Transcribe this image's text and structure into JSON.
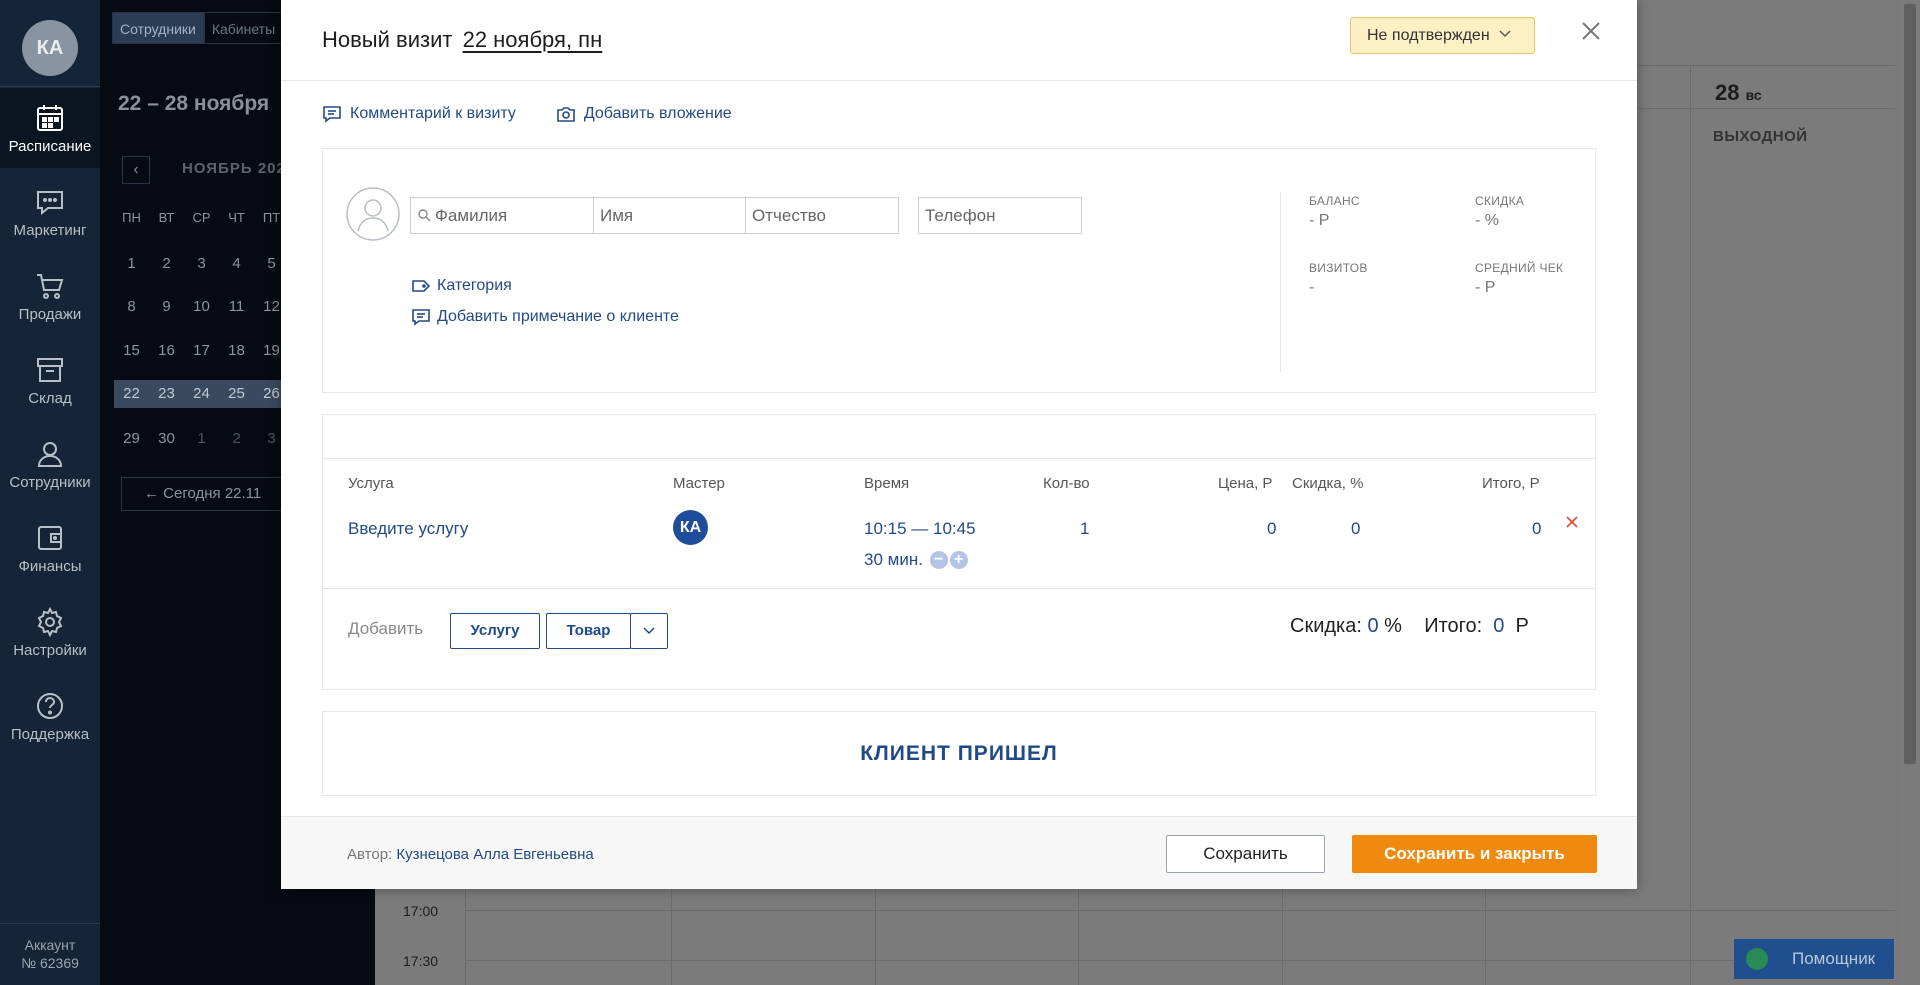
{
  "nav": {
    "avatar": "КА",
    "items": [
      {
        "label": "Расписание"
      },
      {
        "label": "Маркетинг"
      },
      {
        "label": "Продажи"
      },
      {
        "label": "Склад"
      },
      {
        "label": "Сотрудники"
      },
      {
        "label": "Финансы"
      },
      {
        "label": "Настройки"
      },
      {
        "label": "Поддержка"
      }
    ],
    "account_label": "Аккаунт",
    "account_number": "№ 62369"
  },
  "sidebar": {
    "tabs": [
      "Сотрудники",
      "Кабинеты"
    ],
    "range": "22 – 28 ноября",
    "month": "НОЯБРЬ 202",
    "weekdays": [
      "ПН",
      "ВТ",
      "СР",
      "ЧТ",
      "ПТ"
    ],
    "weeks": [
      [
        "1",
        "2",
        "3",
        "4",
        "5"
      ],
      [
        "8",
        "9",
        "10",
        "11",
        "12"
      ],
      [
        "15",
        "16",
        "17",
        "18",
        "19"
      ],
      [
        "22",
        "23",
        "24",
        "25",
        "26"
      ],
      [
        "29",
        "30",
        "1",
        "2",
        "3"
      ]
    ],
    "today_btn": "Сегодня 22.11"
  },
  "schedule": {
    "day_num": "28",
    "day_name": "вс",
    "day_off": "ВЫХОДНОЙ",
    "times": [
      "17:00",
      "17:30"
    ],
    "helper": "Помощник"
  },
  "modal": {
    "title": "Новый визит",
    "date": "22 ноября, пн",
    "status": "Не подтвержден",
    "links": {
      "comment": "Комментарий к визиту",
      "attachment": "Добавить вложение"
    },
    "client": {
      "surname_placeholder": "Фамилия",
      "name_placeholder": "Имя",
      "patronymic_placeholder": "Отчество",
      "phone_placeholder": "Телефон",
      "category": "Категория",
      "note": "Добавить примечание о клиенте",
      "stats": {
        "balance_label": "БАЛАНС",
        "balance": "- Р",
        "discount_label": "СКИДКА",
        "discount": "- %",
        "visits_label": "ВИЗИТОВ",
        "visits": "-",
        "avg_label": "СРЕДНИЙ ЧЕК",
        "avg": "- Р"
      }
    },
    "services": {
      "headers": {
        "service": "Услуга",
        "master": "Мастер",
        "time": "Время",
        "qty": "Кол-во",
        "price": "Цена, Р",
        "discount": "Скидка, %",
        "total": "Итого, Р"
      },
      "row": {
        "service": "Введите услугу",
        "master": "КА",
        "time": "10:15 — 10:45",
        "duration": "30 мин.",
        "qty": "1",
        "price": "0",
        "discount": "0",
        "total": "0"
      },
      "add_label": "Добавить",
      "add_service": "Услугу",
      "add_product": "Товар",
      "summary": {
        "discount_label": "Скидка:",
        "discount_value": "0",
        "discount_unit": "%",
        "total_label": "Итого:",
        "total_value": "0",
        "total_unit": "Р"
      }
    },
    "arrived": "КЛИЕНТ ПРИШЕЛ",
    "footer": {
      "author_label": "Автор:",
      "author": "Кузнецова Алла Евгеньевна",
      "save": "Сохранить",
      "save_close": "Сохранить и закрыть"
    }
  }
}
